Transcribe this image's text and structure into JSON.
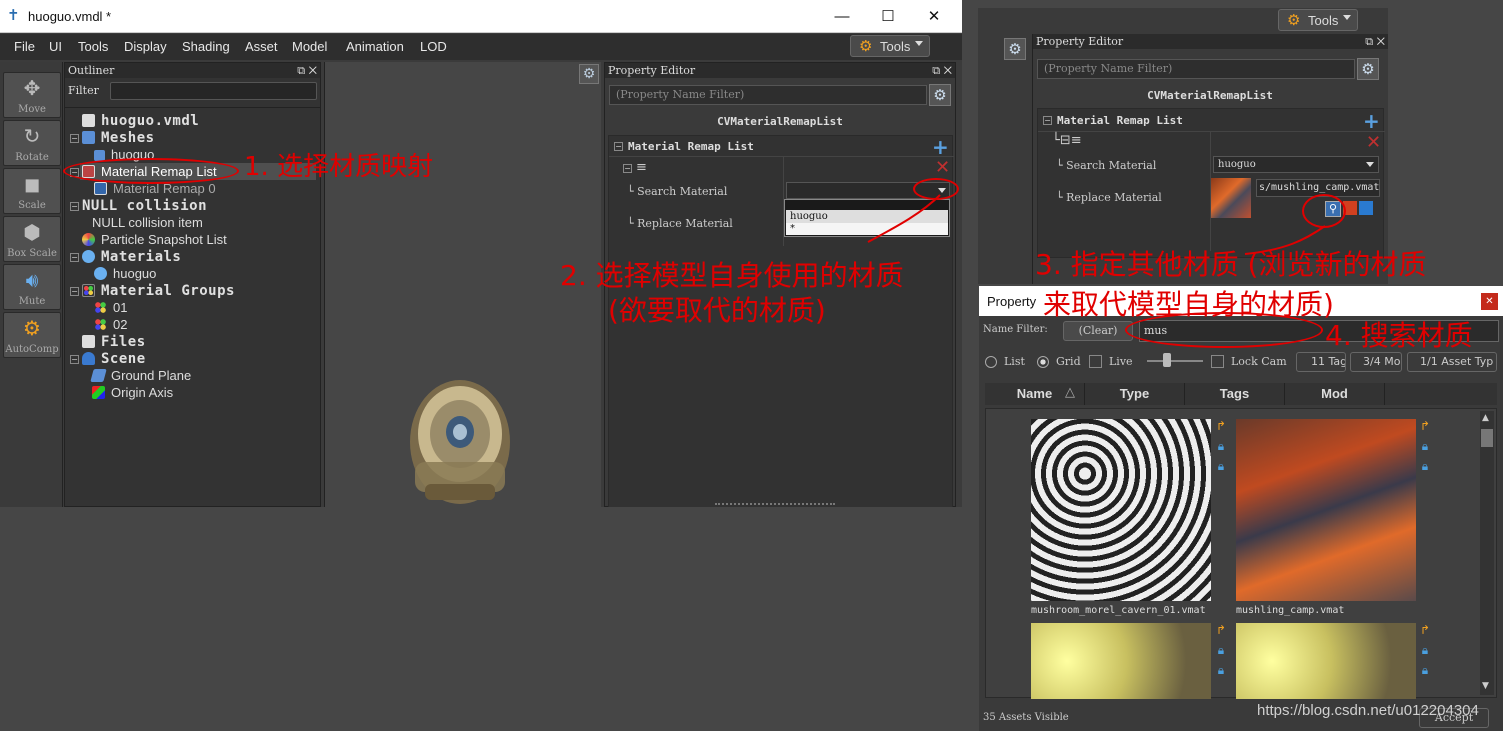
{
  "main_window": {
    "title": "huoguo.vmdl *",
    "controls": {
      "minimize": "—",
      "maximize": "☐",
      "close": "✕"
    },
    "menu": [
      "File",
      "UI",
      "Tools",
      "Display",
      "Shading",
      "Asset",
      "Model",
      "Animation",
      "LOD"
    ],
    "tools_button": "Tools"
  },
  "left_toolbar": [
    "Move",
    "Rotate",
    "Scale",
    "Box Scale",
    "Mute",
    "AutoComp"
  ],
  "outliner": {
    "title": "Outliner",
    "filter_label": "Filter",
    "filter_value": "",
    "items": [
      {
        "label": "huoguo.vmdl",
        "style": "big"
      },
      {
        "label": "Meshes",
        "style": "big"
      },
      {
        "label": "huoguo",
        "style": "small"
      },
      {
        "label": "Material Remap List",
        "style": "small"
      },
      {
        "label": "Material Remap 0",
        "style": "small"
      },
      {
        "label": "NULL collision",
        "style": "big"
      },
      {
        "label": "NULL collision item",
        "style": "small"
      },
      {
        "label": "Particle Snapshot List",
        "style": "small"
      },
      {
        "label": "Materials",
        "style": "big"
      },
      {
        "label": "huoguo",
        "style": "small"
      },
      {
        "label": "Material Groups",
        "style": "big"
      },
      {
        "label": "01",
        "style": "small"
      },
      {
        "label": "02",
        "style": "small"
      },
      {
        "label": "Files",
        "style": "big"
      },
      {
        "label": "Scene",
        "style": "big"
      },
      {
        "label": "Ground Plane",
        "style": "small"
      },
      {
        "label": "Origin Axis",
        "style": "small"
      }
    ]
  },
  "property_editor": {
    "title": "Property Editor",
    "filter_placeholder": "(Property Name Filter)",
    "class_name": "CVMaterialRemapList",
    "section": "Material Remap List",
    "search_label": "Search Material",
    "replace_label": "Replace Material",
    "search_value": "",
    "dropdown_options": [
      "huoguo",
      "*"
    ]
  },
  "property_editor_2": {
    "title": "Property Editor",
    "tools_button": "Tools",
    "filter_placeholder": "(Property Name Filter)",
    "class_name": "CVMaterialRemapList",
    "section": "Material Remap List",
    "search_label": "Search Material",
    "search_value": "huoguo",
    "replace_label": "Replace Material",
    "replace_value": "s/mushling_camp.vmat"
  },
  "asset_browser": {
    "title": "Property",
    "name_filter_label": "Name Filter:",
    "clear_button": "(Clear)",
    "search_value": "mus",
    "view_list": "List",
    "view_grid": "Grid",
    "live": "Live",
    "lock_cam": "Lock Cam",
    "tags_btn": "11 Tag",
    "mods_btn": "3/4 Mo",
    "asset_type_btn": "1/1 Asset Typ",
    "columns": [
      "Name",
      "Type",
      "Tags",
      "Mod"
    ],
    "assets": [
      "mushroom_morel_cavern_01.vmat",
      "mushling_camp.vmat"
    ],
    "status": "35 Assets Visible",
    "accept": "Accept"
  },
  "annotations": {
    "step1": "1. 选择材质映射",
    "step2_line1": "2. 选择模型自身使用的材质",
    "step2_line2": "(欲要取代的材质)",
    "step3_line1": "3. 指定其他材质 (浏览新的材质",
    "step3_line2": "来取代模型自身的材质)",
    "step4": "4. 搜索材质"
  },
  "watermark": "https://blog.csdn.net/u012204304"
}
